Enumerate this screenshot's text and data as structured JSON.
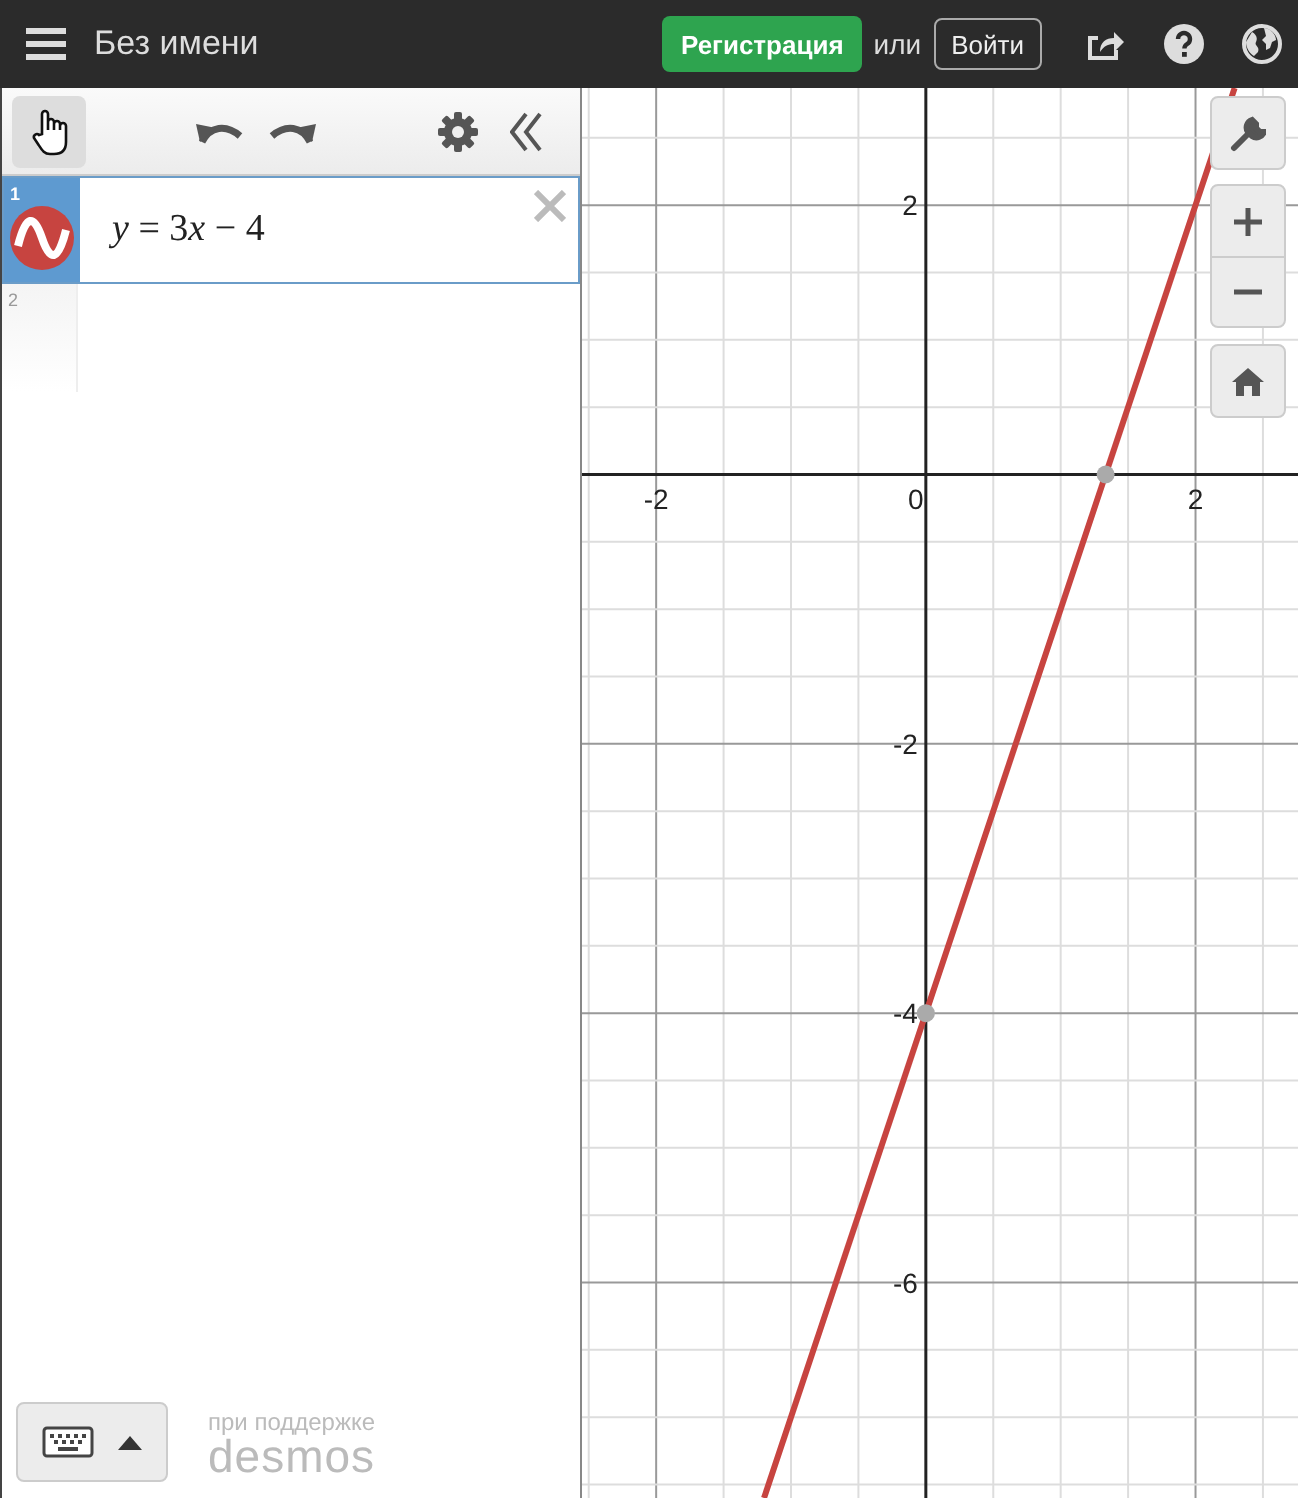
{
  "header": {
    "title": "Без имени",
    "signup_button": "Регистрация",
    "or_text": "или",
    "login_button": "Войти"
  },
  "expressions": [
    {
      "number": "1",
      "text": "y = 3x − 4",
      "color": "#c74440",
      "selected": true
    },
    {
      "number": "2",
      "selected": false
    }
  ],
  "footer": {
    "powered_by": "при поддержке",
    "brand": "desmos"
  },
  "graph": {
    "chart_data": {
      "type": "line",
      "x": [
        -1.2,
        2.29
      ],
      "series": [
        {
          "color": "#c74440",
          "values": [
            -7.6,
            2.87
          ]
        }
      ],
      "xlim": [
        -2.55,
        2.76
      ],
      "ylim": [
        -7.6,
        2.87
      ],
      "grid": true,
      "xticks": [
        {
          "value": -2,
          "label": "-2"
        },
        {
          "value": 0,
          "label": "0"
        },
        {
          "value": 2,
          "label": "2"
        }
      ],
      "yticks": [
        {
          "value": 2,
          "label": "2"
        },
        {
          "value": -2,
          "label": "-2"
        },
        {
          "value": -4,
          "label": "-4"
        },
        {
          "value": -6,
          "label": "-6"
        }
      ]
    }
  }
}
